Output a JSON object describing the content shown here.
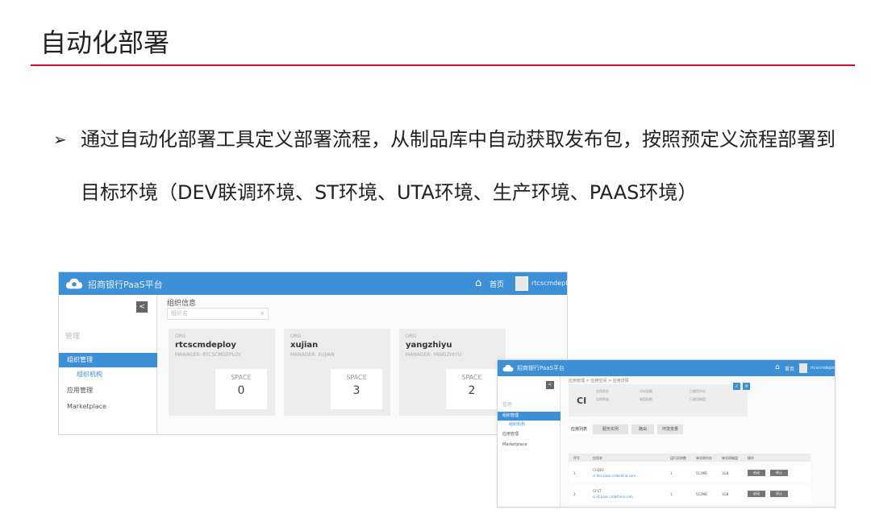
{
  "slide": {
    "title": "自动化部署",
    "bullet_marker": "➢",
    "bullet_text": "通过自动化部署工具定义部署流程，从制品库中自动获取发布包，按照预定义流程部署到目标环境（DEV联调环境、ST环境、UTA环境、生产环境、PAAS环境）"
  },
  "colors": {
    "accent_red": "#c8102e",
    "topbar_blue": "#3d8fd6",
    "card_gray": "#ececec"
  },
  "screen1": {
    "app_title": "招商银行PaaS平台",
    "home_label": "首页",
    "user": "rtcscmdeploy",
    "collapse": "<",
    "sidebar_section": "管理",
    "sidebar": [
      "组织管理",
      "组织机构",
      "应用管理",
      "Marketplace"
    ],
    "page_heading": "组织信息",
    "search_placeholder": "组织名",
    "cards": [
      {
        "label": "ORG",
        "name": "rtcscmdeploy",
        "sub": "MANAGER: RTCSCMDEPLOY",
        "space_label": "SPACE",
        "space_value": "0"
      },
      {
        "label": "ORG",
        "name": "xujian",
        "sub": "MANAGER: XUJIAN",
        "space_label": "SPACE",
        "space_value": "3"
      },
      {
        "label": "ORG",
        "name": "yangzhiyu",
        "sub": "MANAGER: YANGZHIYU",
        "space_label": "SPACE",
        "space_value": "2"
      }
    ]
  },
  "screen2": {
    "app_title": "招商银行PaaS平台",
    "home_label": "首页",
    "user": "rtcscmdeploy",
    "collapse": "<",
    "sidebar_section": "管理",
    "sidebar": [
      "组织管理",
      "组织机构",
      "应用管理",
      "Marketplace"
    ],
    "breadcrumb": "应用管理 > 应用空间 > 应用详情",
    "app_code": "CI",
    "panel_fields": [
      "应用状态",
      "实例数量",
      "内存配额",
      "磁盘配额",
      "已使用内存",
      "已使用磁盘"
    ],
    "tabs": [
      "应用列表",
      "服务实例",
      "路由",
      "环境变量"
    ],
    "table_headers": [
      "序号",
      "应用名",
      "运行实例数",
      "单实例内存",
      "单实例磁盘",
      "操作"
    ],
    "rows": [
      {
        "id": "1",
        "name": "CI-DEV",
        "link": "ci-dev.paas.cmbchina.com",
        "n": "1",
        "mem": "512MB",
        "disk": "1GB",
        "b1": "启动",
        "b2": "停止"
      },
      {
        "id": "2",
        "name": "CI-ST",
        "link": "ci-st.paas.cmbchina.com",
        "n": "1",
        "mem": "512MB",
        "disk": "1GB",
        "b1": "启动",
        "b2": "停止"
      }
    ]
  }
}
